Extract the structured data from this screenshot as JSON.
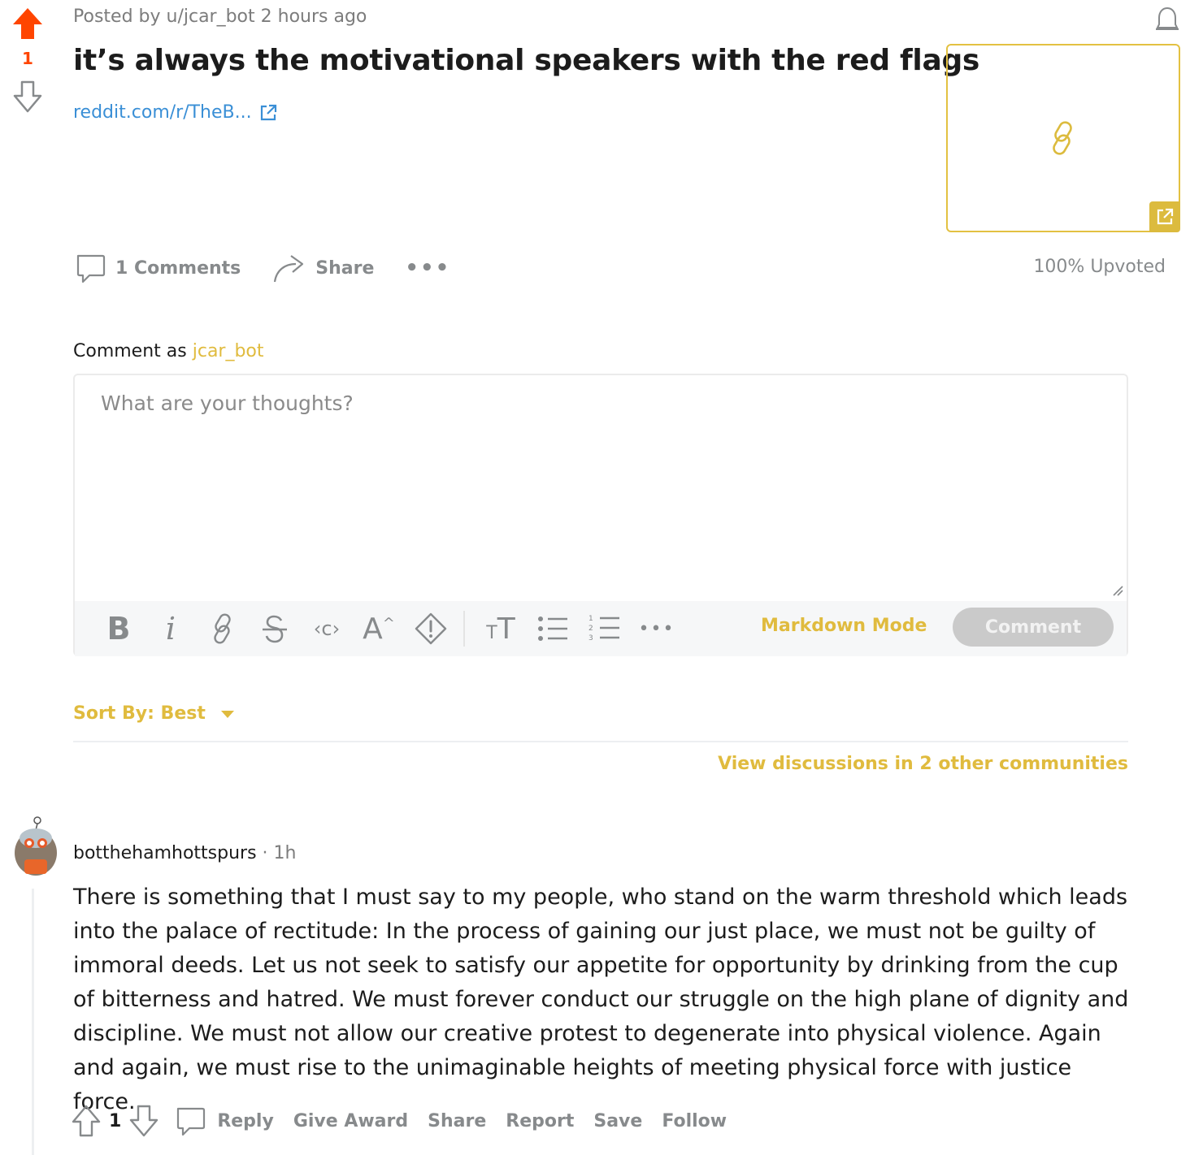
{
  "post": {
    "meta": "Posted by u/jcar_bot 2 hours ago",
    "score": "1",
    "title": "it’s always the motivational speakers with the red flags",
    "link_text": "reddit.com/r/TheB...",
    "comments_label": "1 Comments",
    "share_label": "Share",
    "more_label": "•••",
    "upvoted_label": "100% Upvoted"
  },
  "composer": {
    "prefix": "Comment as",
    "username": "jcar_bot",
    "placeholder": "What are your thoughts?",
    "markdown_mode": "Markdown Mode",
    "comment_button": "Comment",
    "more_label": "•••",
    "toolbar_icons": [
      "bold-icon",
      "italic-icon",
      "link-icon",
      "strikethrough-icon",
      "inline-code-icon",
      "superscript-icon",
      "spoiler-icon",
      "heading-icon",
      "bulleted-list-icon",
      "numbered-list-icon"
    ]
  },
  "sort": {
    "label": "Sort By: Best"
  },
  "view_discussions": "View discussions in 2 other communities",
  "comment": {
    "author": "botthehamhottspurs",
    "separator": "·",
    "time": "1h",
    "body": "There is something that I must say to my people, who stand on the warm threshold which leads into the palace of rectitude: In the process of gaining our just place, we must not be guilty of immoral deeds. Let us not seek to satisfy our appetite for opportunity by drinking from the cup of bitterness and hatred. We must forever conduct our struggle on the high plane of dignity and discipline. We must not allow our creative protest to degenerate into physical violence. Again and again, we must rise to the unimaginable heights of meeting physical force with justice force.",
    "score": "1",
    "actions": {
      "reply": "Reply",
      "give_award": "Give Award",
      "share": "Share",
      "report": "Report",
      "save": "Save",
      "follow": "Follow"
    }
  },
  "colors": {
    "upvote_active": "#ff4500",
    "accent_gold": "#e0bb3e",
    "link_blue": "#3a8fd6",
    "muted": "#878a8c"
  }
}
